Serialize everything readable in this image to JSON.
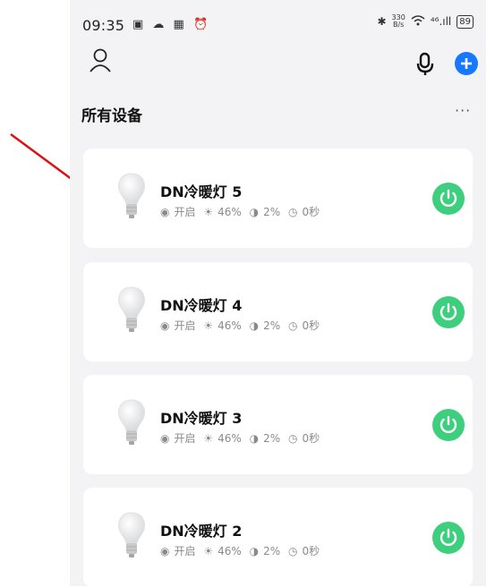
{
  "status_bar": {
    "time": "09:35",
    "left_icons": "▣ ☁ ▦ ⏰",
    "bluetooth": "✱",
    "net_speed_value": "330",
    "net_speed_unit": "B/s",
    "signal": "⁴⁶.ıll",
    "battery": "89"
  },
  "header": {
    "section_title": "所有设备",
    "more_label": "···"
  },
  "devices": [
    {
      "name": "DN冷暖灯 5",
      "state": "开启",
      "brightness": "46%",
      "color_temp": "2%",
      "timer": "0秒"
    },
    {
      "name": "DN冷暖灯 4",
      "state": "开启",
      "brightness": "46%",
      "color_temp": "2%",
      "timer": "0秒"
    },
    {
      "name": "DN冷暖灯 3",
      "state": "开启",
      "brightness": "46%",
      "color_temp": "2%",
      "timer": "0秒"
    },
    {
      "name": "DN冷暖灯 2",
      "state": "开启",
      "brightness": "46%",
      "color_temp": "2%",
      "timer": "0秒"
    }
  ],
  "colors": {
    "accent_blue": "#1677ff",
    "power_green": "#3ecf7e",
    "annotation_red": "#e01010"
  },
  "icons": {
    "user": "user-icon",
    "mic": "microphone-icon",
    "add": "plus-circle-icon",
    "bulb": "light-bulb-icon",
    "power": "power-icon"
  }
}
